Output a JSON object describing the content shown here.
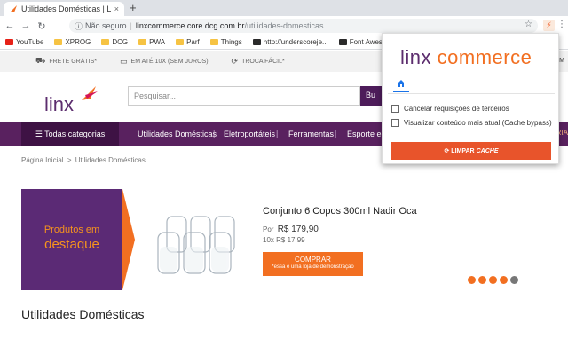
{
  "browser": {
    "tab_title": "Utilidades Domésticas | Linx Com",
    "tab_close": "×",
    "new_tab": "+",
    "address": {
      "security_label": "Não seguro",
      "separator": "|",
      "host": "linxcommerce.core.dcg.com.br",
      "path": "/utilidades-domesticas"
    },
    "bookmarks": [
      {
        "label": "YouTube",
        "icon": "youtube-icon"
      },
      {
        "label": "XPROG",
        "icon": "folder-icon"
      },
      {
        "label": "DCG",
        "icon": "folder-icon"
      },
      {
        "label": "PWA",
        "icon": "folder-icon"
      },
      {
        "label": "Parf",
        "icon": "folder-icon"
      },
      {
        "label": "Things",
        "icon": "folder-icon"
      },
      {
        "label": "http://underscoreje...",
        "icon": "page-icon"
      },
      {
        "label": "Font Awesome Icons",
        "icon": "fontawesome-icon"
      }
    ]
  },
  "store": {
    "topbar": [
      {
        "label": "FRETE GRÁTIS*",
        "icon": "truck-icon"
      },
      {
        "label": "EM ATÉ 10X (SEM JUROS)",
        "icon": "card-icon"
      },
      {
        "label": "TROCA FÁCIL*",
        "icon": "refresh-icon"
      }
    ],
    "topbar_right": "M",
    "logo_text": "linx",
    "search_placeholder": "Pesquisar...",
    "search_button": "Bu",
    "nav": {
      "all_categories": "☰ Todas categorias",
      "items": [
        "Utilidades Domésticas",
        "Eletroportáteis",
        "Ferramentas",
        "Esporte e la"
      ],
      "separator": "|",
      "right_fragment": "RIA"
    },
    "breadcrumb": {
      "home": "Página Inicial",
      "separator": ">",
      "current": "Utilidades Domésticas"
    },
    "featured": {
      "line1": "Produtos em",
      "line2": "destaque"
    },
    "product": {
      "name": "Conjunto 6 Copos 300ml Nadir Oca",
      "price_prefix": "Por",
      "price": "R$ 179,90",
      "installments": "10x R$ 17,99",
      "buy_label": "COMPRAR",
      "buy_note": "*essa é uma loja de demonstração"
    },
    "carousel_dots": 5,
    "carousel_active": 4,
    "section_title": "Utilidades Domésticas"
  },
  "popup": {
    "logo_linx": "linx",
    "logo_commerce": "commerce",
    "options": [
      {
        "label": "Cancelar requisições de terceiros",
        "checked": false
      },
      {
        "label": "Visualizar conteúdo mais atual (Cache bypass)",
        "checked": false
      }
    ],
    "clear_button": "LIMPAR",
    "clear_button_suffix": "CACHE"
  },
  "colors": {
    "brand_purple": "#59215f",
    "brand_orange": "#f26f21",
    "clear_red": "#e8542b"
  }
}
